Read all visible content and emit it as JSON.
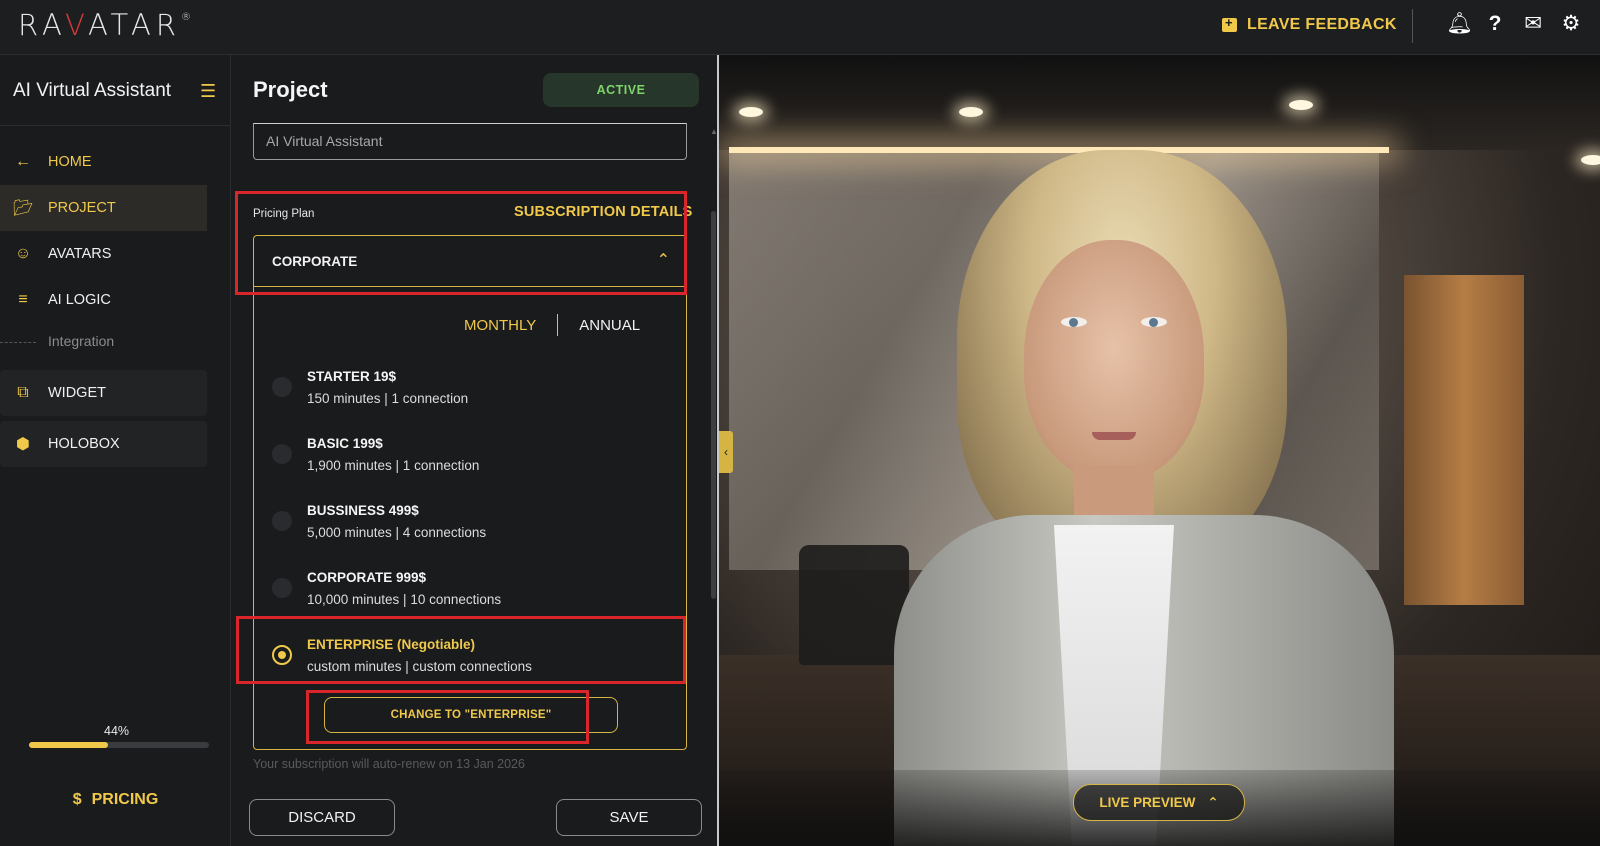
{
  "app": {
    "logo": "RAVATAR",
    "logo_mark": "®"
  },
  "topbar": {
    "feedback_label": "LEAVE FEEDBACK",
    "icons": [
      "bell-icon",
      "help-icon",
      "mail-icon",
      "gear-icon"
    ]
  },
  "sidebar": {
    "title": "AI Virtual Assistant",
    "items": [
      {
        "label": "HOME",
        "icon": "arrow-left-icon"
      },
      {
        "label": "PROJECT",
        "icon": "folder-icon"
      },
      {
        "label": "AVATARS",
        "icon": "users-icon"
      },
      {
        "label": "AI LOGIC",
        "icon": "sliders-icon"
      }
    ],
    "group_label": "Integration",
    "group_items": [
      {
        "label": "WIDGET",
        "icon": "widget-icon"
      },
      {
        "label": "HOLOBOX",
        "icon": "box-icon"
      }
    ],
    "progress": {
      "label": "44%",
      "value": 44
    },
    "pricing_label": "PRICING",
    "pricing_symbol": "$"
  },
  "panel": {
    "title": "Project",
    "status": "ACTIVE",
    "name_value": "AI Virtual Assistant",
    "pricing_label": "Pricing Plan",
    "subscription_link": "SUBSCRIPTION DETAILS",
    "selected_plan": "CORPORATE",
    "period": {
      "monthly": "MONTHLY",
      "annual": "ANNUAL"
    },
    "plans": [
      {
        "name": "STARTER 19$",
        "desc": "150 minutes | 1 connection",
        "selected": false
      },
      {
        "name": "BASIC 199$",
        "desc": "1,900 minutes | 1 connection",
        "selected": false
      },
      {
        "name": "BUSSINESS 499$",
        "desc": "5,000 minutes | 4 connections",
        "selected": false
      },
      {
        "name": "CORPORATE 999$",
        "desc": "10,000 minutes | 10 connections",
        "selected": false
      },
      {
        "name": "ENTERPRISE (Negotiable)",
        "desc": "custom minutes | custom connections",
        "selected": true
      }
    ],
    "change_button": "CHANGE TO \"ENTERPRISE\"",
    "autorenew_note": "Your subscription will auto-renew on 13 Jan 2026",
    "discard_label": "DISCARD",
    "save_label": "SAVE"
  },
  "preview": {
    "live_preview_label": "LIVE PREVIEW"
  },
  "colors": {
    "accent": "#f0c94b",
    "highlight": "#d8262a",
    "active_bg": "#27362a",
    "active_text": "#7fd36b"
  }
}
